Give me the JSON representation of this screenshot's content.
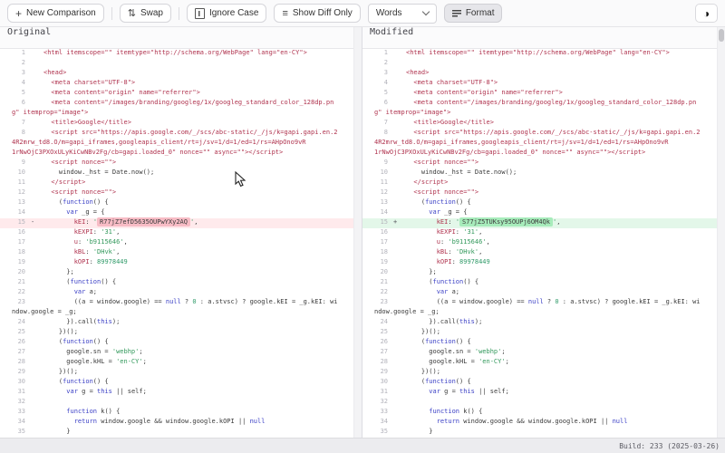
{
  "toolbar": {
    "new_comparison": "New Comparison",
    "swap": "Swap",
    "ignore_case": "Ignore Case",
    "show_diff_only": "Show Diff Only",
    "words": "Words",
    "format": "Format",
    "plus_glyph": "+",
    "swap_glyph": "⇅",
    "list_glyph": "≡",
    "theme_glyph": "◑"
  },
  "panels": {
    "original_title": "Original",
    "modified_title": "Modified"
  },
  "footer": {
    "build": "Build: 233 (2025-03-26)"
  },
  "colors": {
    "deleted_row_bg": "#ffeaec",
    "deleted_word_bg": "#f7bcc5",
    "inserted_row_bg": "#e3f7e9",
    "inserted_word_bg": "#a7ecbb",
    "html_token": "#b0344f",
    "keyword_token": "#3c41c6",
    "string_token": "#33995c"
  },
  "diff": {
    "lines": [
      {
        "n": 1,
        "rows": [
          [
            [
              "t",
              "<html itemscope=\"\" itemtype=\"http://schema.org/WebPage\" lang=\"en-CY\">"
            ]
          ]
        ]
      },
      {
        "n": 2,
        "rows": [
          []
        ]
      },
      {
        "n": 3,
        "rows": [
          [
            [
              "t",
              "<head>"
            ]
          ]
        ]
      },
      {
        "n": 4,
        "rows": [
          [
            [
              "t",
              "  <meta charset=\"UTF-8\">"
            ]
          ]
        ]
      },
      {
        "n": 5,
        "rows": [
          [
            [
              "t",
              "  <meta content=\"origin\" name=\"referrer\">"
            ]
          ]
        ]
      },
      {
        "n": 6,
        "rows": [
          [
            [
              "t",
              "  <meta content=\"/images/branding/googleg/1x/googleg_standard_color_128dp.pn"
            ]
          ],
          [
            [
              "t",
              "g\" itemprop=\"image\">"
            ]
          ]
        ]
      },
      {
        "n": 7,
        "rows": [
          [
            [
              "t",
              "  <title>Google</title>"
            ]
          ]
        ]
      },
      {
        "n": 8,
        "rows": [
          [
            [
              "t",
              "  <script src=\"https://apis.google.com/_/scs/abc-static/_/js/k=gapi.gapi.en.2"
            ]
          ],
          [
            [
              "t",
              "4R2mrw_td8.O/m=gapi_iframes,googleapis_client/rt=j/sv=1/d=1/ed=1/rs=AHpOno9vR"
            ]
          ],
          [
            [
              "t",
              "1rNwOjC3PXOxULyKiCwNBv2Fg/cb=gapi.loaded_0\" nonce=\"\" async=\"\"></script>"
            ]
          ]
        ]
      },
      {
        "n": 9,
        "rows": [
          [
            [
              "t",
              "  <script nonce=\"\">"
            ]
          ]
        ]
      },
      {
        "n": 10,
        "rows": [
          [
            [
              "p",
              "    window._hst = Date.now();"
            ]
          ]
        ]
      },
      {
        "n": 11,
        "rows": [
          [
            [
              "t",
              "  </script>"
            ]
          ]
        ]
      },
      {
        "n": 12,
        "rows": [
          [
            [
              "t",
              "  <script nonce=\"\">"
            ]
          ]
        ]
      },
      {
        "n": 13,
        "rows": [
          [
            [
              "p",
              "    ("
            ],
            [
              "k",
              "function"
            ],
            [
              "p",
              "() {"
            ]
          ]
        ]
      },
      {
        "n": 14,
        "rows": [
          [
            [
              "p",
              "      "
            ],
            [
              "k",
              "var"
            ],
            [
              "p",
              " _g = {"
            ]
          ]
        ]
      },
      {
        "n": 15,
        "left": {
          "cls": "del",
          "marker": "-",
          "rows": [
            [
              [
                "p",
                "        "
              ],
              [
                "t",
                "kEI"
              ],
              [
                "p",
                ": "
              ],
              [
                "s",
                "'"
              ],
              [
                "hd",
                "R77jZ7efD5635OUPwYXy2AQ"
              ],
              [
                "s",
                "'"
              ],
              [
                "p",
                ","
              ]
            ]
          ]
        },
        "right": {
          "cls": "ins",
          "marker": "+",
          "rows": [
            [
              [
                "p",
                "        "
              ],
              [
                "t",
                "kEI"
              ],
              [
                "p",
                ": "
              ],
              [
                "s",
                "'"
              ],
              [
                "hi",
                "S77jZ5TUKsy95OUPj6OM4Qk"
              ],
              [
                "s",
                "'"
              ],
              [
                "p",
                ","
              ]
            ]
          ]
        }
      },
      {
        "n": 16,
        "rows": [
          [
            [
              "p",
              "        "
            ],
            [
              "t",
              "kEXPI"
            ],
            [
              "p",
              ": "
            ],
            [
              "s",
              "'31'"
            ],
            [
              "p",
              ","
            ]
          ]
        ]
      },
      {
        "n": 17,
        "rows": [
          [
            [
              "p",
              "        "
            ],
            [
              "t",
              "u"
            ],
            [
              "p",
              ": "
            ],
            [
              "s",
              "'b9115646'"
            ],
            [
              "p",
              ","
            ]
          ]
        ]
      },
      {
        "n": 18,
        "rows": [
          [
            [
              "p",
              "        "
            ],
            [
              "t",
              "kBL"
            ],
            [
              "p",
              ": "
            ],
            [
              "s",
              "'DHvk'"
            ],
            [
              "p",
              ","
            ]
          ]
        ]
      },
      {
        "n": 19,
        "rows": [
          [
            [
              "p",
              "        "
            ],
            [
              "t",
              "kOPI"
            ],
            [
              "p",
              ": "
            ],
            [
              "n",
              "89978449"
            ]
          ]
        ]
      },
      {
        "n": 20,
        "rows": [
          [
            [
              "p",
              "      };"
            ]
          ]
        ]
      },
      {
        "n": 21,
        "rows": [
          [
            [
              "p",
              "      ("
            ],
            [
              "k",
              "function"
            ],
            [
              "p",
              "() {"
            ]
          ]
        ]
      },
      {
        "n": 22,
        "rows": [
          [
            [
              "p",
              "        "
            ],
            [
              "k",
              "var"
            ],
            [
              "p",
              " a;"
            ]
          ]
        ]
      },
      {
        "n": 23,
        "rows": [
          [
            [
              "p",
              "        ((a = window.google) == "
            ],
            [
              "k",
              "null"
            ],
            [
              "p",
              " ? "
            ],
            [
              "n",
              "0"
            ],
            [
              "p",
              " : a.stvsc) ? google.kEI = _g.kEI: wi"
            ]
          ],
          [
            [
              "p",
              "ndow.google = _g;"
            ]
          ]
        ]
      },
      {
        "n": 24,
        "rows": [
          [
            [
              "p",
              "      }).call("
            ],
            [
              "k",
              "this"
            ],
            [
              "p",
              ");"
            ]
          ]
        ]
      },
      {
        "n": 25,
        "rows": [
          [
            [
              "p",
              "    })();"
            ]
          ]
        ]
      },
      {
        "n": 26,
        "rows": [
          [
            [
              "p",
              "    ("
            ],
            [
              "k",
              "function"
            ],
            [
              "p",
              "() {"
            ]
          ]
        ]
      },
      {
        "n": 27,
        "rows": [
          [
            [
              "p",
              "      google.sn = "
            ],
            [
              "s",
              "'webhp'"
            ],
            [
              "p",
              ";"
            ]
          ]
        ]
      },
      {
        "n": 28,
        "rows": [
          [
            [
              "p",
              "      google.kHL = "
            ],
            [
              "s",
              "'en-CY'"
            ],
            [
              "p",
              ";"
            ]
          ]
        ]
      },
      {
        "n": 29,
        "rows": [
          [
            [
              "p",
              "    })();"
            ]
          ]
        ]
      },
      {
        "n": 30,
        "rows": [
          [
            [
              "p",
              "    ("
            ],
            [
              "k",
              "function"
            ],
            [
              "p",
              "() {"
            ]
          ]
        ]
      },
      {
        "n": 31,
        "rows": [
          [
            [
              "p",
              "      "
            ],
            [
              "k",
              "var"
            ],
            [
              "p",
              " g = "
            ],
            [
              "k",
              "this"
            ],
            [
              "p",
              " || self;"
            ]
          ]
        ]
      },
      {
        "n": 32,
        "rows": [
          []
        ]
      },
      {
        "n": 33,
        "rows": [
          [
            [
              "p",
              "      "
            ],
            [
              "k",
              "function"
            ],
            [
              "p",
              " k() {"
            ]
          ]
        ]
      },
      {
        "n": 34,
        "rows": [
          [
            [
              "p",
              "        "
            ],
            [
              "k",
              "return"
            ],
            [
              "p",
              " window.google && window.google.kOPI || "
            ],
            [
              "k",
              "null"
            ]
          ]
        ]
      },
      {
        "n": 35,
        "rows": [
          [
            [
              "p",
              "      }"
            ]
          ]
        ]
      }
    ]
  }
}
